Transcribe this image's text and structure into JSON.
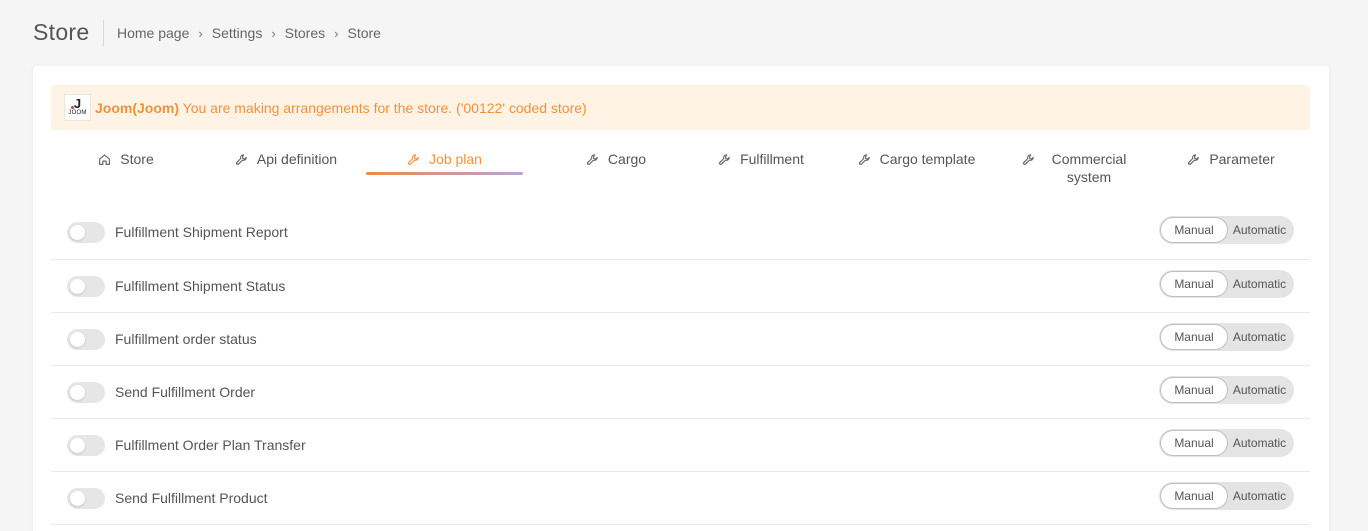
{
  "header": {
    "title": "Store",
    "breadcrumb": [
      "Home page",
      "Settings",
      "Stores",
      "Store"
    ]
  },
  "alert": {
    "logo_text": "JOOM",
    "store_name": "Joom(Joom)",
    "message": "You are making arrangements for the store. ('00122' coded store)"
  },
  "tabs": [
    {
      "label": "Store",
      "icon": "home-icon"
    },
    {
      "label": "Api definition",
      "icon": "wrench-icon"
    },
    {
      "label": "Job plan",
      "icon": "wrench-icon",
      "active": true
    },
    {
      "label": "Cargo",
      "icon": "wrench-icon"
    },
    {
      "label": "Fulfillment",
      "icon": "wrench-icon"
    },
    {
      "label": "Cargo template",
      "icon": "wrench-icon"
    },
    {
      "label": "Commercial system",
      "icon": "wrench-icon"
    },
    {
      "label": "Parameter",
      "icon": "wrench-icon"
    }
  ],
  "jobs": [
    {
      "label": "Fulfillment Shipment Report",
      "enabled": false,
      "manual_label": "Manual",
      "automatic_label": "Automatic",
      "mode": "Manual"
    },
    {
      "label": "Fulfillment Shipment Status",
      "enabled": false,
      "manual_label": "Manual",
      "automatic_label": "Automatic",
      "mode": "Manual"
    },
    {
      "label": "Fulfillment order status",
      "enabled": false,
      "manual_label": "Manual",
      "automatic_label": "Automatic",
      "mode": "Manual"
    },
    {
      "label": "Send Fulfillment Order",
      "enabled": false,
      "manual_label": "Manual",
      "automatic_label": "Automatic",
      "mode": "Manual"
    },
    {
      "label": "Fulfillment Order Plan Transfer",
      "enabled": false,
      "manual_label": "Manual",
      "automatic_label": "Automatic",
      "mode": "Manual"
    },
    {
      "label": "Send Fulfillment Product",
      "enabled": false,
      "manual_label": "Manual",
      "automatic_label": "Automatic",
      "mode": "Manual"
    }
  ],
  "colors": {
    "accent": "#f0923a",
    "alert_bg": "#fff3e6",
    "tab_underline_start": "#f08a42",
    "tab_underline_end": "#b9a2dc"
  }
}
